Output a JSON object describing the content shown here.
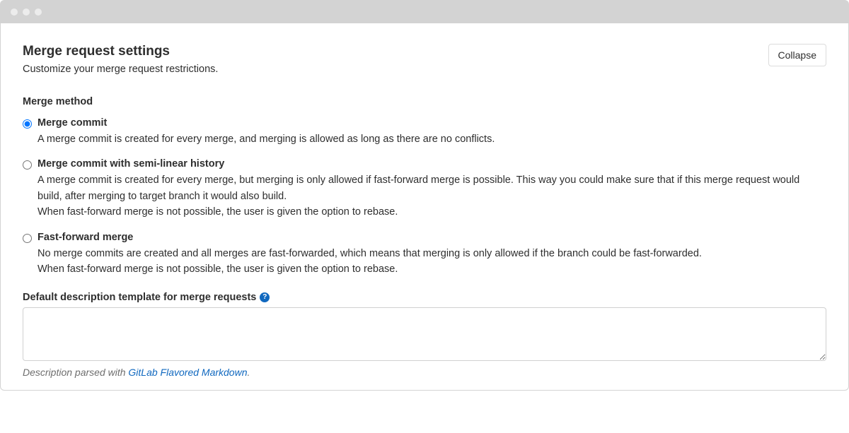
{
  "header": {
    "title": "Merge request settings",
    "subtitle": "Customize your merge request restrictions.",
    "collapse_label": "Collapse"
  },
  "merge_method": {
    "label": "Merge method",
    "options": [
      {
        "title": "Merge commit",
        "desc1": "A merge commit is created for every merge, and merging is allowed as long as there are no conflicts.",
        "desc2": "",
        "selected": true
      },
      {
        "title": "Merge commit with semi-linear history",
        "desc1": "A merge commit is created for every merge, but merging is only allowed if fast-forward merge is possible. This way you could make sure that if this merge request would build, after merging to target branch it would also build.",
        "desc2": "When fast-forward merge is not possible, the user is given the option to rebase.",
        "selected": false
      },
      {
        "title": "Fast-forward merge",
        "desc1": "No merge commits are created and all merges are fast-forwarded, which means that merging is only allowed if the branch could be fast-forwarded.",
        "desc2": "When fast-forward merge is not possible, the user is given the option to rebase.",
        "selected": false
      }
    ]
  },
  "template": {
    "label": "Default description template for merge requests",
    "help_icon": "?",
    "value": "",
    "note_prefix": "Description parsed with ",
    "note_link": "GitLab Flavored Markdown",
    "note_suffix": "."
  }
}
